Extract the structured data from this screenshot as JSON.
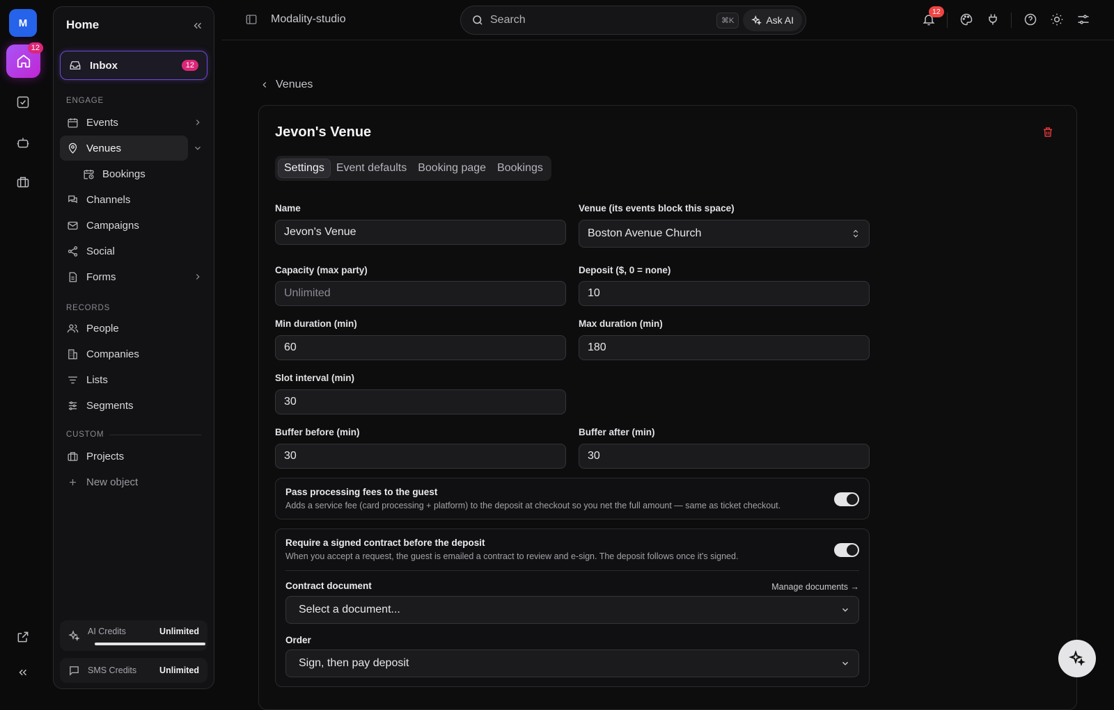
{
  "rail": {
    "avatar_initial": "M",
    "home_badge": "12"
  },
  "sidebar": {
    "title": "Home",
    "inbox": {
      "label": "Inbox",
      "badge": "12"
    },
    "sections": {
      "engage": "ENGAGE",
      "records": "RECORDS",
      "custom": "CUSTOM"
    },
    "engage_items": [
      {
        "label": "Events"
      },
      {
        "label": "Venues"
      },
      {
        "label": "Bookings"
      },
      {
        "label": "Channels"
      },
      {
        "label": "Campaigns"
      },
      {
        "label": "Social"
      },
      {
        "label": "Forms"
      }
    ],
    "record_items": [
      {
        "label": "People"
      },
      {
        "label": "Companies"
      },
      {
        "label": "Lists"
      },
      {
        "label": "Segments"
      }
    ],
    "custom_items": [
      {
        "label": "Projects"
      },
      {
        "label": "New object"
      }
    ],
    "credits": [
      {
        "name": "AI Credits",
        "value": "Unlimited",
        "usage_fraction": 1.0
      },
      {
        "name": "SMS Credits",
        "value": "Unlimited"
      }
    ]
  },
  "topbar": {
    "project": "Modality-studio",
    "search_placeholder": "Search",
    "shortcut": "⌘K",
    "ask_ai": "Ask AI",
    "notif_badge": "12"
  },
  "breadcrumb": "Venues",
  "venue": {
    "title": "Jevon's Venue",
    "tabs": [
      "Settings",
      "Event defaults",
      "Booking page",
      "Bookings"
    ],
    "fields": {
      "name_label": "Name",
      "name_value": "Jevon's Venue",
      "venue_label": "Venue (its events block this space)",
      "venue_value": "Boston Avenue Church",
      "capacity_label": "Capacity (max party)",
      "capacity_placeholder": "Unlimited",
      "deposit_label": "Deposit ($, 0 = none)",
      "deposit_value": "10",
      "min_label": "Min duration (min)",
      "min_value": "60",
      "max_label": "Max duration (min)",
      "max_value": "180",
      "slot_label": "Slot interval (min)",
      "slot_value": "30",
      "buf_before_label": "Buffer before (min)",
      "buf_before_value": "30",
      "buf_after_label": "Buffer after (min)",
      "buf_after_value": "30"
    },
    "fees": {
      "title": "Pass processing fees to the guest",
      "desc": "Adds a service fee (card processing + platform) to the deposit at checkout so you net the full amount — same as ticket checkout.",
      "enabled": true
    },
    "contract": {
      "title": "Require a signed contract before the deposit",
      "desc": "When you accept a request, the guest is emailed a contract to review and e-sign. The deposit follows once it's signed.",
      "enabled": true,
      "doc_label": "Contract document",
      "manage": "Manage documents →",
      "doc_value": "Select a document...",
      "order_label": "Order",
      "order_value": "Sign, then pay deposit"
    }
  }
}
